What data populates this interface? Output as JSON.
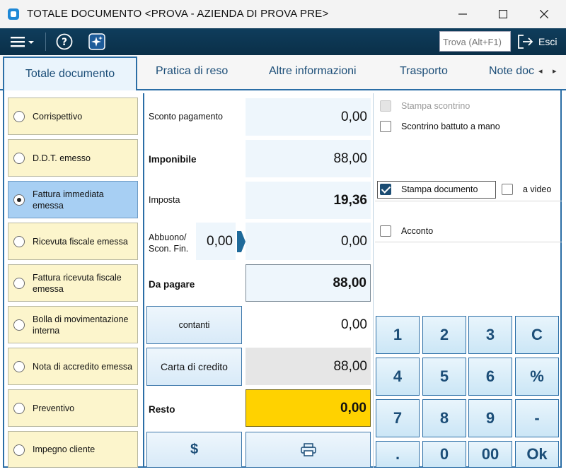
{
  "window": {
    "title": "TOTALE DOCUMENTO <PROVA - AZIENDA DI PROVA PRE>",
    "minimize": "—",
    "maximize": "☐",
    "close": "✕"
  },
  "toolbar": {
    "search_placeholder": "Trova (Alt+F1)",
    "exit_label": "Esci"
  },
  "tabs": [
    {
      "label": "Totale documento",
      "active": true
    },
    {
      "label": "Pratica di reso"
    },
    {
      "label": "Altre informazioni"
    },
    {
      "label": "Trasporto"
    },
    {
      "label": "Note doc"
    }
  ],
  "document_types": [
    {
      "label": "Corrispettivo",
      "selected": false
    },
    {
      "label": "D.D.T. emesso",
      "selected": false
    },
    {
      "label": "Fattura immediata emessa",
      "selected": true
    },
    {
      "label": "Ricevuta fiscale emessa",
      "selected": false
    },
    {
      "label": "Fattura ricevuta fiscale emessa",
      "selected": false
    },
    {
      "label": "Bolla di movimentazione interna",
      "selected": false
    },
    {
      "label": "Nota di accredito emessa",
      "selected": false
    },
    {
      "label": "Preventivo",
      "selected": false
    },
    {
      "label": "Impegno cliente",
      "selected": false
    }
  ],
  "totals": {
    "sconto_pagamento_label": "Sconto pagamento",
    "sconto_pagamento": "0,00",
    "imponibile_label": "Imponibile",
    "imponibile": "88,00",
    "imposta_label": "Imposta",
    "imposta": "19,36",
    "abbuono_label": "Abbuono/\nScon. Fin.",
    "abbuono_percent": "0,00",
    "abbuono": "0,00",
    "da_pagare_label": "Da pagare",
    "da_pagare": "88,00",
    "contanti_label": "contanti",
    "contanti": "0,00",
    "carta_label": "Carta di credito",
    "carta": "88,00",
    "resto_label": "Resto",
    "resto": "0,00",
    "dollar_label": "$"
  },
  "options": {
    "stampa_scontrino": "Stampa scontrino",
    "scontrino_mano": "Scontrino battuto a mano",
    "stampa_documento": "Stampa documento",
    "a_video": "a video",
    "acconto": "Acconto"
  },
  "keypad": [
    "1",
    "2",
    "3",
    "C",
    "4",
    "5",
    "6",
    "%",
    "7",
    "8",
    "9",
    "-",
    ".",
    "0",
    "00",
    "Ok"
  ],
  "colors": {
    "accent": "#2b6ea6",
    "toolbar": "#0f3d5c",
    "selected_doc": "#a7cff3",
    "doc_bg": "#fcf5cc",
    "resto_bg": "#ffd200"
  }
}
